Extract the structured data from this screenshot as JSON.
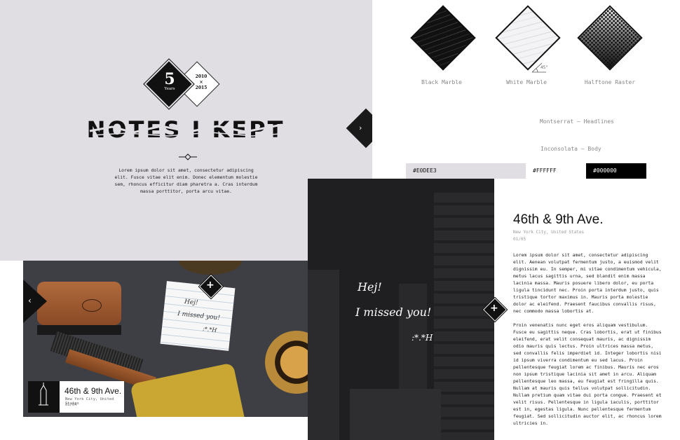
{
  "hero": {
    "badge_number": "5",
    "badge_word": "Years",
    "badge_year_start": "2010",
    "badge_year_sep": "×",
    "badge_year_end": "2015",
    "logo_text": "NOTES I KEPT",
    "body": "Lorem ipsum dolor sit amet, consectetur adipiscing elit. Fusce vitae elit enim. Donec elementum molestie sem, rhoncus efficitur diam pharetra a. Cras interdum massa porttitor, porta arcu vitae.",
    "arrow_icon": "chevron-right-icon"
  },
  "styleguide": {
    "swatches": [
      {
        "label": "Black Marble",
        "color": "#111111"
      },
      {
        "label": "White Marble",
        "color": "#ececef"
      },
      {
        "label": "Halftone Raster",
        "color": "#555555"
      }
    ],
    "angle_label": "45°",
    "fonts": [
      {
        "label": "Montserrat – Headlines"
      },
      {
        "label": "Inconsolata – Body"
      }
    ],
    "colors": [
      {
        "hex": "#E0DEE3",
        "value": "#e0dee3"
      },
      {
        "hex": "#FFFFFF",
        "value": "#ffffff"
      },
      {
        "hex": "#000000",
        "value": "#000000"
      }
    ]
  },
  "photo_panel": {
    "note_line1": "Hej!",
    "note_line2": "I missed you!",
    "note_sign": ":*.*H",
    "card_title": "46th & 9th Ave.",
    "card_sub": "New York City, United States",
    "card_count": "01/04",
    "prev_icon": "chevron-left-icon",
    "expand_icon": "plus-icon"
  },
  "street_panel": {
    "line1": "Hej!",
    "line2": "I missed you!",
    "sign": ":*.*H",
    "expand_icon": "plus-icon"
  },
  "article": {
    "title": "46th & 9th Ave.",
    "sub": "New York City, United States",
    "count": "01/05",
    "para1": "Lorem ipsum dolor sit amet, consectetur adipiscing elit. Aenean volutpat fermentum justo, a euismod velit dignissim eu. In semper, mi vitae condimentum vehicula, metus lacus sagittis urna, sed blandit enim massa lacinia massa. Mauris posuere libero dolor, eu porta ligula tincidunt nec. Proin porta interdum justo, quis tristique tortor maximus in. Mauris porta molestie dolor ac eleifend. Praesent faucibus convallis risus, nec commodo massa lobortis at.",
    "para2": "Proin venenatis nunc eget eros aliquam vestibulum. Fusce eu sagittis neque. Cras lobortis, erat ut finibus eleifend, erat velit consequat mauris, ac dignissim odio mauris quis lectus. Proin ultrices massa metus, sed convallis felis imperdiet id. Integer lobortis nisi id ipsum viverra condimentum eu sed lacus. Proin pellentesque feugiat lorem ac finibus. Mauris nec eros non ipsum tristique lacinia sit amet in arcu. Aliquam pellentesque leo massa, eu feugiat est fringilla quis. Nullam at mauris quis tellus volutpat sollicitudin.",
    "para3": "Nullam pretium quam vitae dui porta congue. Praesent et velit risus. Pellentesque in ligula iaculis, porttitor est in, egestas ligula. Nunc pellentesque fermentum feugiat. Sed sollicitudin auctor elit, ac rhoncus lorem ultricies in."
  }
}
